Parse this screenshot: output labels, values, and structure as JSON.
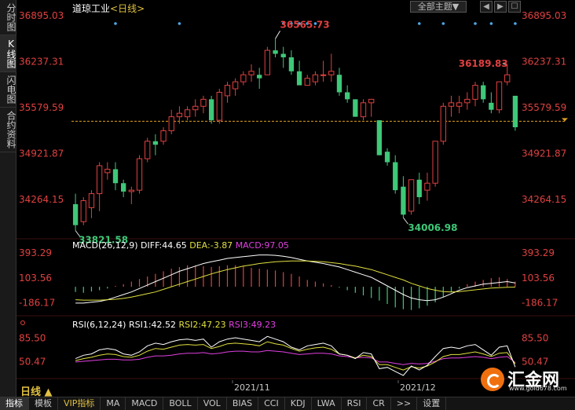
{
  "left_tabs": [
    "分时图",
    "K线图",
    "闪电图",
    "合约资料"
  ],
  "left_tab_active": 1,
  "title": "道琼工业",
  "period": "<日线>",
  "theme_button": "全部主题▼",
  "window_buttons": [
    "◀",
    "▶",
    "☐"
  ],
  "price_axis": {
    "labels": [
      "36895.03",
      "36237.31",
      "35579.59",
      "34921.87",
      "34264.15"
    ]
  },
  "annotations": {
    "high": "36565.73",
    "high2": "36189.83",
    "low": "33821.58",
    "low2": "34006.98"
  },
  "macd": {
    "label_name": "MACD(26,12,9)",
    "diff_text": "DIFF:44.65",
    "dea_text": "DEA:-3.87",
    "macd_text": "MACD:97.05",
    "axis_labels": [
      "393.29",
      "103.56",
      "-186.17"
    ]
  },
  "rsi": {
    "label_name": "RSI(6,12,24)",
    "rsi1_text": "RSI1:42.52",
    "rsi2_text": "RSI2:47.23",
    "rsi3_text": "RSI3:49.23",
    "axis_labels": [
      "85.50",
      "50.47"
    ]
  },
  "date_labels": [
    "2021/11",
    "2021/12"
  ],
  "period_tab": "日线 ▲",
  "bottom_tabs": [
    "指标",
    "模板",
    "VIP指标",
    "MA",
    "MACD",
    "BOLL",
    "VOL",
    "BIAS",
    "CCI",
    "KDJ",
    "LWA",
    "RSI",
    "CR",
    ">>",
    "设置"
  ],
  "bottom_tab_active": 0,
  "logo": {
    "name": "汇金网",
    "site": "www.gold678.com"
  },
  "colors": {
    "up": "#e04040",
    "down": "#3ec878",
    "dashed": "#e0a020",
    "macd_diff": "#ffffff",
    "macd_dea": "#e0e040",
    "rsi1": "#ffffff",
    "rsi2": "#e0e040",
    "rsi3": "#e040e0"
  },
  "chart_data": {
    "type": "candlestick",
    "title": "道琼工业",
    "ylim": [
      33821.58,
      36895.03
    ],
    "candles": [
      {
        "o": 34200,
        "h": 34350,
        "l": 33821.58,
        "c": 33900
      },
      {
        "o": 33950,
        "h": 34300,
        "l": 33900,
        "c": 34250
      },
      {
        "o": 34150,
        "h": 34400,
        "l": 34000,
        "c": 34350
      },
      {
        "o": 34350,
        "h": 34800,
        "l": 34100,
        "c": 34750
      },
      {
        "o": 34650,
        "h": 34800,
        "l": 34550,
        "c": 34700
      },
      {
        "o": 34700,
        "h": 34800,
        "l": 34400,
        "c": 34500
      },
      {
        "o": 34500,
        "h": 34550,
        "l": 34300,
        "c": 34380
      },
      {
        "o": 34380,
        "h": 34450,
        "l": 34200,
        "c": 34400
      },
      {
        "o": 34400,
        "h": 34900,
        "l": 34350,
        "c": 34850
      },
      {
        "o": 34850,
        "h": 35150,
        "l": 34800,
        "c": 35100
      },
      {
        "o": 35100,
        "h": 35200,
        "l": 34900,
        "c": 35050
      },
      {
        "o": 35100,
        "h": 35300,
        "l": 35050,
        "c": 35250
      },
      {
        "o": 35250,
        "h": 35550,
        "l": 35200,
        "c": 35450
      },
      {
        "o": 35450,
        "h": 35600,
        "l": 35350,
        "c": 35500
      },
      {
        "o": 35450,
        "h": 35600,
        "l": 35400,
        "c": 35550
      },
      {
        "o": 35550,
        "h": 35700,
        "l": 35450,
        "c": 35600
      },
      {
        "o": 35600,
        "h": 35750,
        "l": 35500,
        "c": 35700
      },
      {
        "o": 35700,
        "h": 35750,
        "l": 35350,
        "c": 35400
      },
      {
        "o": 35400,
        "h": 35850,
        "l": 35350,
        "c": 35800
      },
      {
        "o": 35750,
        "h": 35950,
        "l": 35650,
        "c": 35900
      },
      {
        "o": 35850,
        "h": 36000,
        "l": 35750,
        "c": 35950
      },
      {
        "o": 35950,
        "h": 36100,
        "l": 35900,
        "c": 36050
      },
      {
        "o": 36050,
        "h": 36200,
        "l": 35950,
        "c": 36100
      },
      {
        "o": 36050,
        "h": 36150,
        "l": 35850,
        "c": 36000
      },
      {
        "o": 36050,
        "h": 36450,
        "l": 36050,
        "c": 36400
      },
      {
        "o": 36400,
        "h": 36565.73,
        "l": 36300,
        "c": 36350
      },
      {
        "o": 36350,
        "h": 36450,
        "l": 36150,
        "c": 36300
      },
      {
        "o": 36300,
        "h": 36400,
        "l": 36050,
        "c": 36100
      },
      {
        "o": 36100,
        "h": 36250,
        "l": 35950,
        "c": 35900
      },
      {
        "o": 35900,
        "h": 36050,
        "l": 35900,
        "c": 36000
      },
      {
        "o": 35950,
        "h": 36100,
        "l": 35900,
        "c": 36050
      },
      {
        "o": 36050,
        "h": 36250,
        "l": 35950,
        "c": 36050
      },
      {
        "o": 36050,
        "h": 36350,
        "l": 35950,
        "c": 36100
      },
      {
        "o": 36050,
        "h": 36150,
        "l": 35750,
        "c": 35800
      },
      {
        "o": 35800,
        "h": 35900,
        "l": 35650,
        "c": 35700
      },
      {
        "o": 35700,
        "h": 35700,
        "l": 35450,
        "c": 35450
      },
      {
        "o": 35450,
        "h": 35700,
        "l": 35400,
        "c": 35650
      },
      {
        "o": 35650,
        "h": 35700,
        "l": 35450,
        "c": 35700
      },
      {
        "o": 35400,
        "h": 35400,
        "l": 34900,
        "c": 34900
      },
      {
        "o": 34950,
        "h": 35000,
        "l": 34750,
        "c": 34800
      },
      {
        "o": 34800,
        "h": 34900,
        "l": 34350,
        "c": 34400
      },
      {
        "o": 34450,
        "h": 34600,
        "l": 34006.98,
        "c": 34050
      },
      {
        "o": 34100,
        "h": 34550,
        "l": 34050,
        "c": 34550
      },
      {
        "o": 34550,
        "h": 34650,
        "l": 34200,
        "c": 34300
      },
      {
        "o": 34400,
        "h": 34650,
        "l": 34250,
        "c": 34500
      },
      {
        "o": 34500,
        "h": 35100,
        "l": 34450,
        "c": 35100
      },
      {
        "o": 35100,
        "h": 35650,
        "l": 35050,
        "c": 35600
      },
      {
        "o": 35600,
        "h": 35750,
        "l": 35450,
        "c": 35650
      },
      {
        "o": 35600,
        "h": 35750,
        "l": 35500,
        "c": 35650
      },
      {
        "o": 35650,
        "h": 35800,
        "l": 35550,
        "c": 35700
      },
      {
        "o": 35700,
        "h": 35950,
        "l": 35600,
        "c": 35900
      },
      {
        "o": 35900,
        "h": 35950,
        "l": 35650,
        "c": 35700
      },
      {
        "o": 35650,
        "h": 35800,
        "l": 35500,
        "c": 35550
      },
      {
        "o": 35550,
        "h": 35950,
        "l": 35500,
        "c": 35950
      },
      {
        "o": 35950,
        "h": 36189.83,
        "l": 35900,
        "c": 36050
      },
      {
        "o": 35750,
        "h": 35750,
        "l": 35250,
        "c": 35300
      }
    ],
    "last_price": 35385,
    "macd": {
      "ylim": [
        -300,
        430
      ],
      "hist": [
        -60,
        -70,
        -55,
        -40,
        -20,
        10,
        30,
        60,
        90,
        120,
        150,
        180,
        210,
        230,
        250,
        250,
        240,
        230,
        240,
        250,
        250,
        240,
        220,
        210,
        200,
        190,
        170,
        150,
        120,
        80,
        60,
        40,
        20,
        -10,
        -40,
        -70,
        -100,
        -130,
        -160,
        -200,
        -240,
        -260,
        -270,
        -250,
        -220,
        -180,
        -120,
        -60,
        -20,
        30,
        60,
        80,
        100,
        110,
        90,
        60
      ],
      "diff": [
        -190,
        -190,
        -180,
        -170,
        -150,
        -120,
        -90,
        -60,
        -20,
        20,
        60,
        100,
        140,
        180,
        210,
        240,
        270,
        290,
        310,
        330,
        340,
        350,
        360,
        370,
        370,
        365,
        355,
        340,
        320,
        300,
        285,
        270,
        250,
        230,
        200,
        170,
        140,
        110,
        60,
        10,
        -40,
        -90,
        -130,
        -150,
        -160,
        -150,
        -120,
        -80,
        -40,
        -10,
        10,
        30,
        40,
        50,
        60,
        44.65
      ],
      "dea": [
        -150,
        -155,
        -155,
        -155,
        -150,
        -145,
        -135,
        -120,
        -100,
        -80,
        -60,
        -30,
        0,
        30,
        60,
        90,
        120,
        150,
        175,
        200,
        220,
        240,
        255,
        270,
        280,
        290,
        295,
        300,
        300,
        300,
        295,
        290,
        280,
        270,
        255,
        240,
        220,
        200,
        170,
        140,
        110,
        80,
        40,
        10,
        -20,
        -40,
        -55,
        -60,
        -55,
        -45,
        -35,
        -25,
        -15,
        -10,
        -5,
        -3.87
      ]
    },
    "rsi": {
      "ylim": [
        30,
        100
      ],
      "rsi1": [
        55,
        60,
        62,
        68,
        70,
        68,
        62,
        60,
        65,
        74,
        78,
        76,
        80,
        83,
        84,
        82,
        84,
        72,
        80,
        84,
        86,
        84,
        82,
        80,
        88,
        84,
        80,
        72,
        68,
        74,
        76,
        78,
        74,
        62,
        60,
        55,
        64,
        62,
        40,
        42,
        36,
        30,
        44,
        38,
        45,
        58,
        70,
        72,
        70,
        74,
        76,
        68,
        60,
        72,
        74,
        42.52
      ],
      "rsi2": [
        52,
        55,
        57,
        60,
        62,
        61,
        58,
        57,
        60,
        66,
        70,
        69,
        72,
        75,
        76,
        75,
        76,
        70,
        73,
        77,
        78,
        77,
        76,
        74,
        80,
        77,
        75,
        70,
        66,
        69,
        71,
        72,
        69,
        62,
        60,
        56,
        60,
        58,
        46,
        46,
        42,
        38,
        43,
        41,
        44,
        50,
        58,
        61,
        61,
        63,
        65,
        62,
        58,
        63,
        64,
        47.23
      ],
      "rsi3": [
        50,
        51,
        52,
        53,
        54,
        54,
        53,
        53,
        54,
        57,
        59,
        59,
        60,
        62,
        63,
        63,
        64,
        62,
        63,
        65,
        66,
        66,
        65,
        65,
        67,
        66,
        65,
        63,
        61,
        62,
        63,
        63,
        62,
        59,
        58,
        56,
        57,
        56,
        50,
        50,
        48,
        46,
        48,
        47,
        48,
        51,
        55,
        56,
        56,
        57,
        58,
        57,
        55,
        57,
        58,
        49.23
      ]
    }
  }
}
